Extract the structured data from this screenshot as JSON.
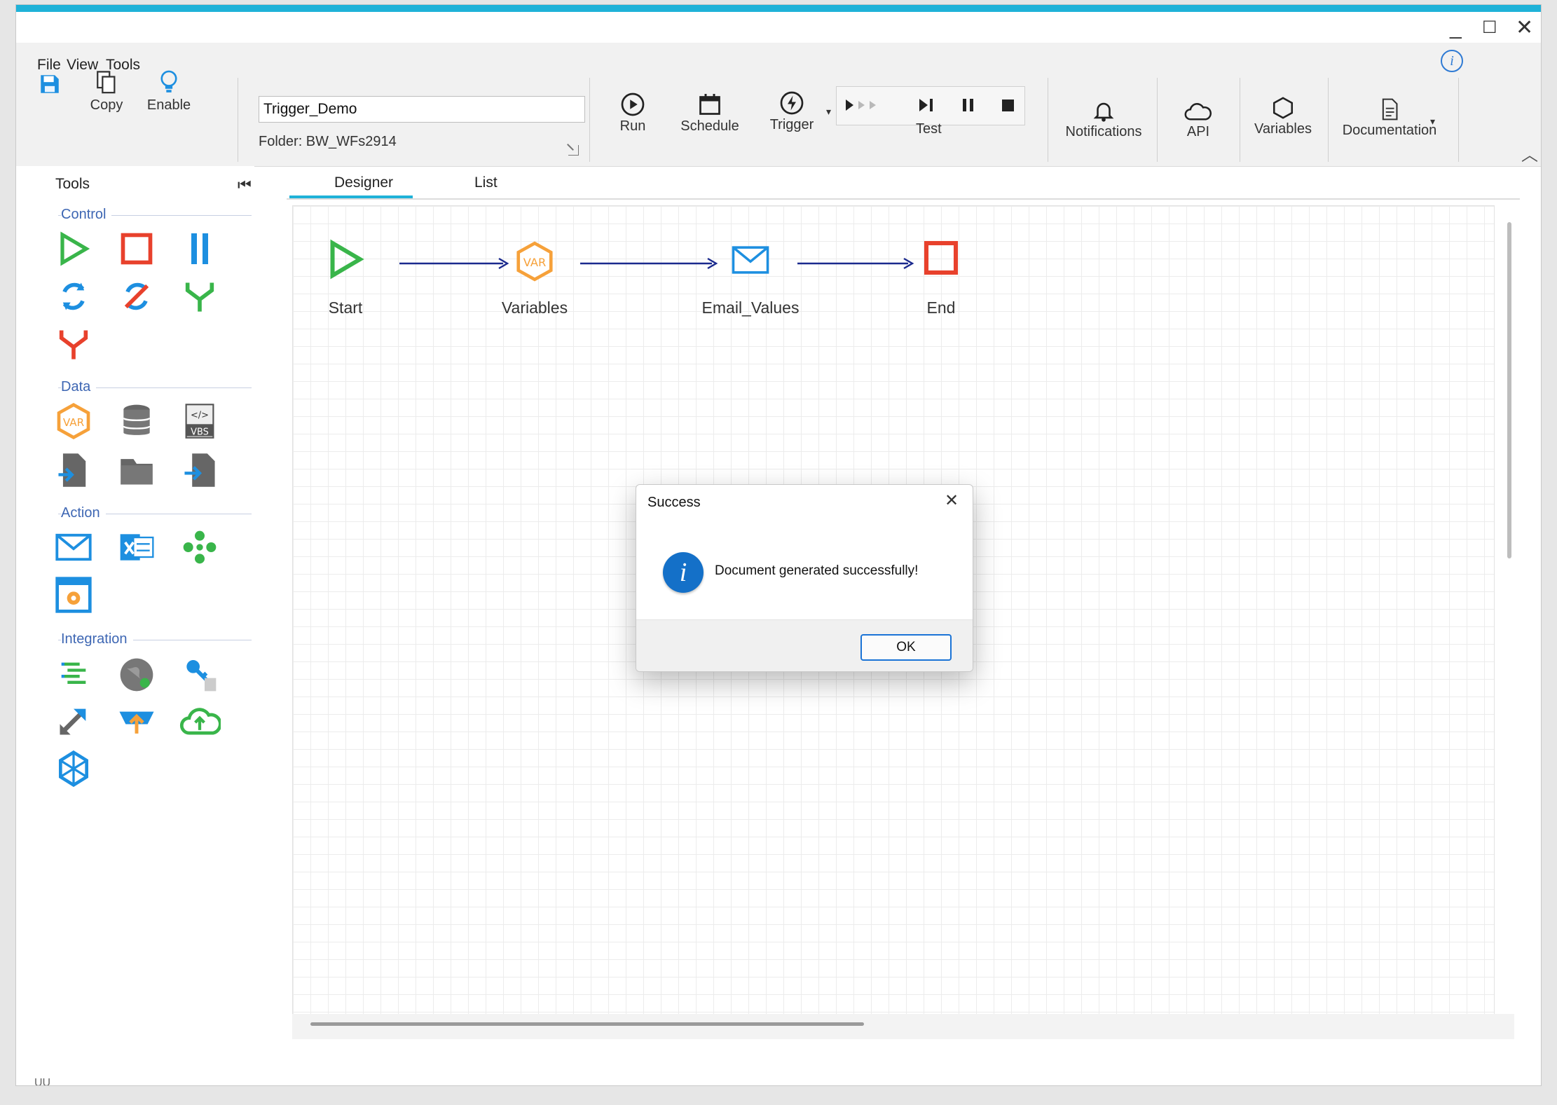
{
  "window": {
    "controls": {
      "minimize": "_",
      "maximize": "☐",
      "close": "✕"
    }
  },
  "menu": {
    "items": [
      "File",
      "View",
      "Tools"
    ]
  },
  "ribbon": {
    "save_label": "",
    "copy_label": "Copy",
    "enable_label": "Enable",
    "workflow_name": "Trigger_Demo",
    "folder_label": "Folder: BW_WFs2914",
    "run_label": "Run",
    "schedule_label": "Schedule",
    "trigger_label": "Trigger",
    "test_label": "Test",
    "notifications_label": "Notifications",
    "api_label": "API",
    "variables_label": "Variables",
    "documentation_label": "Documentation"
  },
  "tools_panel": {
    "title": "Tools",
    "sections": {
      "control": "Control",
      "data": "Data",
      "action": "Action",
      "integration": "Integration"
    },
    "icons": {
      "control": [
        "start-icon",
        "stop-icon",
        "parallel-icon",
        "loop-icon",
        "loop-break-icon",
        "merge-icon",
        "split-icon"
      ],
      "data": [
        "variables-icon",
        "database-icon",
        "vbscript-icon",
        "file-transform-icon",
        "folder-icon",
        "file-import-icon"
      ],
      "action": [
        "email-icon",
        "excel-icon",
        "nodes-icon",
        "process-icon"
      ],
      "integration": [
        "list-icon",
        "web-icon",
        "api-key-icon",
        "share-icon",
        "upload-icon",
        "cloud-icon",
        "network-icon"
      ]
    }
  },
  "tabs": [
    "Designer",
    "List"
  ],
  "workflow": {
    "nodes": [
      {
        "label": "Start",
        "icon": "start-icon"
      },
      {
        "label": "Variables",
        "icon": "variables-icon"
      },
      {
        "label": "Email_Values",
        "icon": "email-icon"
      },
      {
        "label": "End",
        "icon": "stop-icon"
      }
    ]
  },
  "dialog": {
    "title": "Success",
    "message": "Document generated successfully!",
    "ok_label": "OK",
    "close": "✕"
  },
  "status": {
    "text": "UU"
  },
  "colors": {
    "accent": "#1fb2d8",
    "green": "#39b54a",
    "red": "#e8412c",
    "blue": "#1d8fe0",
    "orange": "#f6a13a",
    "arrow": "#1b2a8e"
  }
}
